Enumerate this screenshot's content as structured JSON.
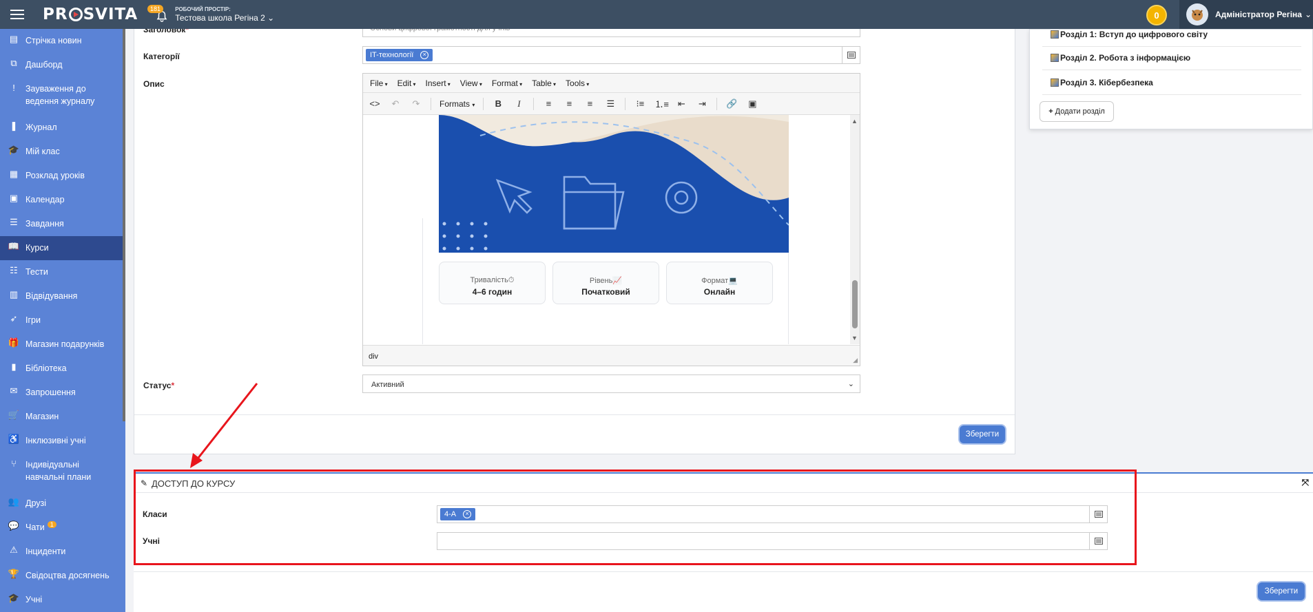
{
  "topbar": {
    "brand": "PROSVITA",
    "brand_pre": "PR",
    "brand_post": "SVITA",
    "notifications_count": "181",
    "workspace_label": "РОБОЧИЙ ПРОСТІР:",
    "workspace_value": "Тестова школа Регіна 2",
    "coins": "0",
    "user_name": "Адміністратор Регіна"
  },
  "sidebar": {
    "items": [
      {
        "label": "Стрічка новин",
        "icon": "news-icon"
      },
      {
        "label": "Дашборд",
        "icon": "dashboard-icon"
      },
      {
        "label": "Зауваження до ведення журналу",
        "icon": "exclamation-icon"
      },
      {
        "label": "Журнал",
        "icon": "bookmark-icon"
      },
      {
        "label": "Мій клас",
        "icon": "graduation-cap-icon"
      },
      {
        "label": "Розклад уроків",
        "icon": "schedule-icon"
      },
      {
        "label": "Календар",
        "icon": "calendar-icon"
      },
      {
        "label": "Завдання",
        "icon": "tasks-icon"
      },
      {
        "label": "Курси",
        "icon": "book-open-icon"
      },
      {
        "label": "Тести",
        "icon": "tests-icon"
      },
      {
        "label": "Відвідування",
        "icon": "attendance-icon"
      },
      {
        "label": "Ігри",
        "icon": "rocket-icon"
      },
      {
        "label": "Магазин подарунків",
        "icon": "gift-icon"
      },
      {
        "label": "Бібліотека",
        "icon": "library-icon"
      },
      {
        "label": "Запрошення",
        "icon": "envelope-icon"
      },
      {
        "label": "Магазин",
        "icon": "cart-icon"
      },
      {
        "label": "Інклюзивні учні",
        "icon": "inclusive-icon"
      },
      {
        "label": "Індивідуальні навчальні плани",
        "icon": "branch-icon"
      },
      {
        "label": "Друзі",
        "icon": "friends-icon"
      },
      {
        "label": "Чати",
        "icon": "chat-icon",
        "badge": "1"
      },
      {
        "label": "Інциденти",
        "icon": "warning-icon"
      },
      {
        "label": "Свідоцтва досягнень",
        "icon": "trophy-icon"
      },
      {
        "label": "Учні",
        "icon": "graduation-cap-icon"
      }
    ],
    "active_index": 8
  },
  "edit_form": {
    "title_label": "Заголовок",
    "title_value": "Основи цифрової грамотності для учнів",
    "categories_label": "Категорії",
    "category_chip": "IT-технології",
    "description_label": "Опис",
    "menu": [
      "File",
      "Edit",
      "Insert",
      "View",
      "Format",
      "Table",
      "Tools"
    ],
    "formats_label": "Formats",
    "editor_path": "div",
    "info_cards": [
      {
        "key": "Тривалість",
        "value": "4–6 годин",
        "emoji": "⏱"
      },
      {
        "key": "Рівень",
        "value": "Початковий",
        "emoji": "📈"
      },
      {
        "key": "Формат",
        "value": "Онлайн",
        "emoji": "💻"
      }
    ],
    "status_label": "Статус",
    "status_value": "Активний",
    "save_label": "Зберегти"
  },
  "sections": {
    "items": [
      "Розділ 1: Вступ до цифрового світу",
      "Розділ 2. Робота з інформацією",
      "Розділ 3. Кібербезпека"
    ],
    "add_label": "Додати розділ"
  },
  "access": {
    "title": "ДОСТУП ДО КУРСУ",
    "classes_label": "Класи",
    "class_chip": "4-А",
    "students_label": "Учні",
    "save_label": "Зберегти"
  },
  "colors": {
    "sidebar": "#5b83d6",
    "sidebar_active": "#2e4a8f",
    "topbar": "#3d4f63",
    "accent": "#4a7bd2",
    "highlight": "#e8151c"
  }
}
